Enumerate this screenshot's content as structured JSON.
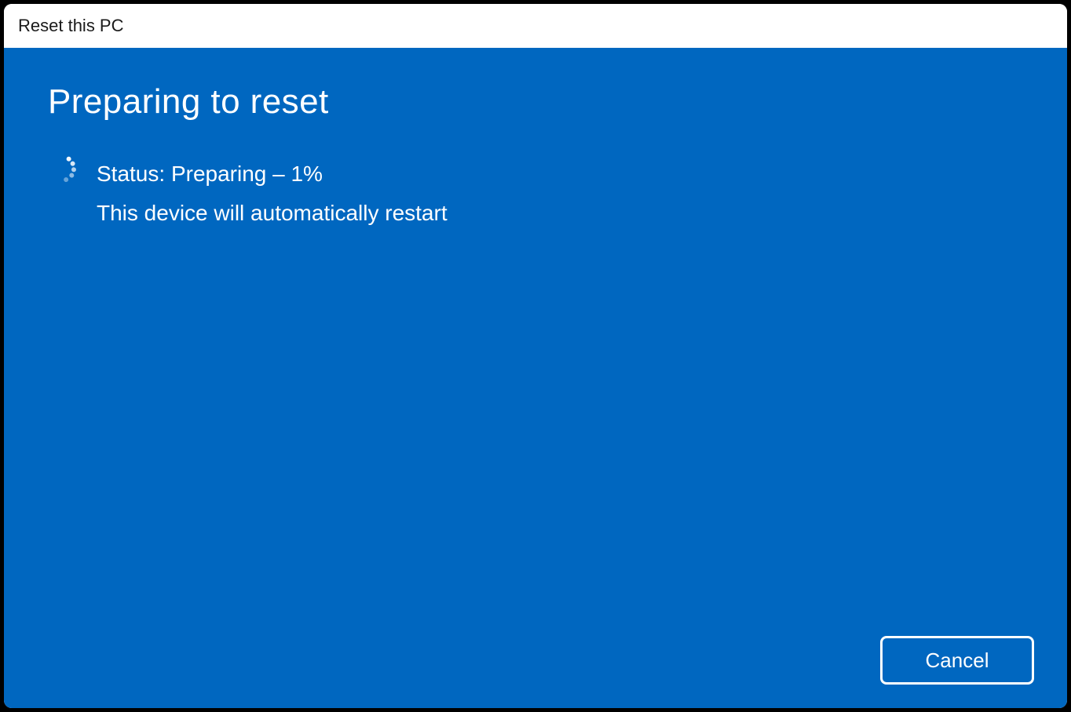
{
  "dialog": {
    "title": "Reset this PC"
  },
  "content": {
    "heading": "Preparing to reset",
    "status_line": "Status: Preparing – 1%",
    "info_line": "This device will automatically restart"
  },
  "footer": {
    "cancel_label": "Cancel"
  },
  "colors": {
    "accent_background": "#0067C0",
    "text_on_accent": "#FFFFFF"
  }
}
